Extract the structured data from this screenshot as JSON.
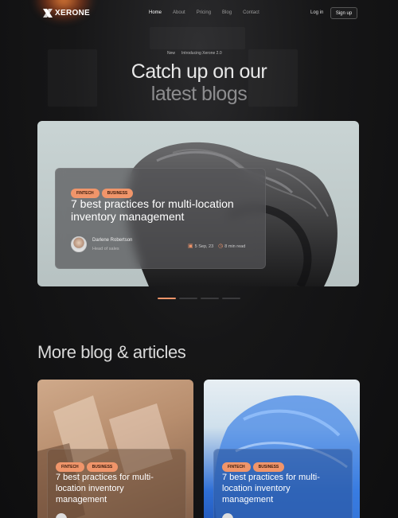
{
  "nav": {
    "logo_text": "XERONE",
    "links": [
      "Home",
      "About",
      "Pricing",
      "Blog",
      "Contact"
    ],
    "login_label": "Log in",
    "signup_label": "Sign up"
  },
  "hero": {
    "badge_new": "New",
    "badge_text": "Introducing Xerone 2.0",
    "title_line1": "Catch up on our",
    "title_line2": "latest blogs"
  },
  "featured": {
    "tags": [
      "FINTECH",
      "BUSINESS"
    ],
    "title": "7 best practices for multi-location inventory management",
    "author_name": "Darlene Robertson",
    "author_role": "Head of sales",
    "date": "5 Sep, 23",
    "read_time": "8 min read",
    "active_slide": 1,
    "slide_count": 4
  },
  "more": {
    "title": "More blog & articles",
    "cards": [
      {
        "tags": [
          "FINTECH",
          "BUSINESS"
        ],
        "title": "7 best practices for multi-location inventory management"
      },
      {
        "tags": [
          "FINTECH",
          "BUSINESS"
        ],
        "title": "7 best practices for multi-location inventory management"
      }
    ]
  },
  "colors": {
    "accent": "#f0956a",
    "background": "#0f0f10"
  }
}
